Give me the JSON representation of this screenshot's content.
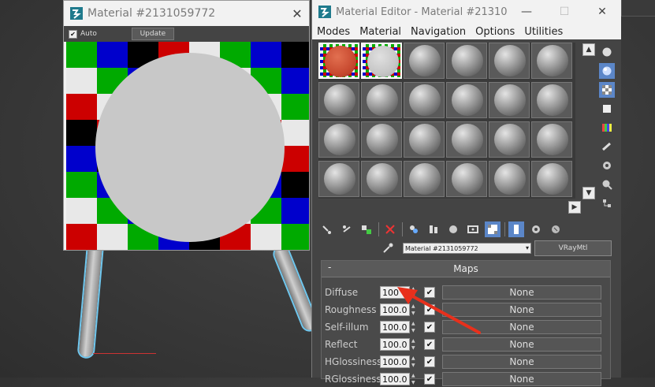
{
  "preview": {
    "title": "Material #2131059772",
    "close_glyph": "✕",
    "auto_label": "Auto",
    "auto_checked": true,
    "update_label": "Update"
  },
  "editor": {
    "title": "Material Editor - Material #213105...",
    "window_controls": {
      "minimize": "—",
      "maximize": "☐",
      "close": "✕"
    },
    "menu": [
      "Modes",
      "Material",
      "Navigation",
      "Options",
      "Utilities"
    ],
    "scroll_up": "▲",
    "scroll_down": "▼",
    "scroll_right": "▶",
    "material_name": "Material #2131059772",
    "material_type": "VRayMtl",
    "maps": {
      "title": "Maps",
      "collapse": "-",
      "rows": [
        {
          "label": "Diffuse",
          "value": "100",
          "checked": true,
          "map": "None"
        },
        {
          "label": "Roughness",
          "value": "100.0",
          "checked": true,
          "map": "None"
        },
        {
          "label": "Self-illum",
          "value": "100.0",
          "checked": true,
          "map": "None"
        },
        {
          "label": "Reflect",
          "value": "100.0",
          "checked": true,
          "map": "None"
        },
        {
          "label": "HGlossiness",
          "value": "100.0",
          "checked": true,
          "map": "None"
        },
        {
          "label": "RGlossiness",
          "value": "100.0",
          "checked": true,
          "map": "None"
        }
      ]
    }
  },
  "colors": {
    "accent_selected": "#5b86c8",
    "annotation_arrow": "#e8301c",
    "material_red": "#c84a30"
  },
  "icons": [
    "app-3dsmax-icon",
    "close-icon",
    "eyedropper-icon",
    "sample-type-icon",
    "backlight-icon",
    "background-icon",
    "arrow-right-icon"
  ]
}
